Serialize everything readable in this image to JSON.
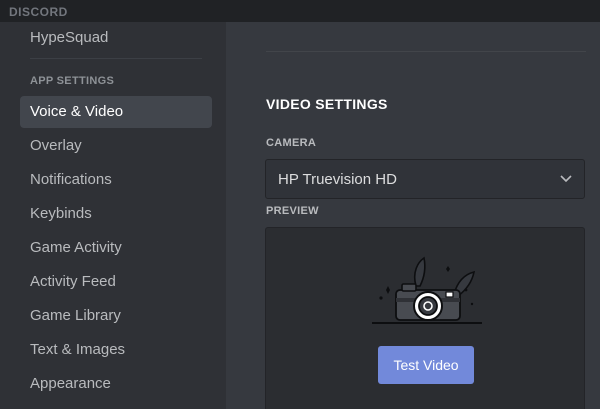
{
  "app": {
    "brand": "DISCORD"
  },
  "sidebar": {
    "top_item": "HypeSquad",
    "section_header": "APP SETTINGS",
    "items": [
      {
        "label": "Voice & Video",
        "active": true
      },
      {
        "label": "Overlay"
      },
      {
        "label": "Notifications"
      },
      {
        "label": "Keybinds"
      },
      {
        "label": "Game Activity"
      },
      {
        "label": "Activity Feed"
      },
      {
        "label": "Game Library"
      },
      {
        "label": "Text & Images"
      },
      {
        "label": "Appearance"
      }
    ]
  },
  "main": {
    "title": "VIDEO SETTINGS",
    "camera_label": "CAMERA",
    "camera_value": "HP Truevision HD",
    "preview_label": "PREVIEW",
    "test_button": "Test Video"
  },
  "colors": {
    "accent": "#7289da",
    "sidebar_bg": "#2f3136",
    "content_bg": "#36393f",
    "titlebar_bg": "#202225"
  },
  "icons": {
    "dropdown": "chevron-down-icon",
    "preview_art": "camera-illustration-icon"
  }
}
